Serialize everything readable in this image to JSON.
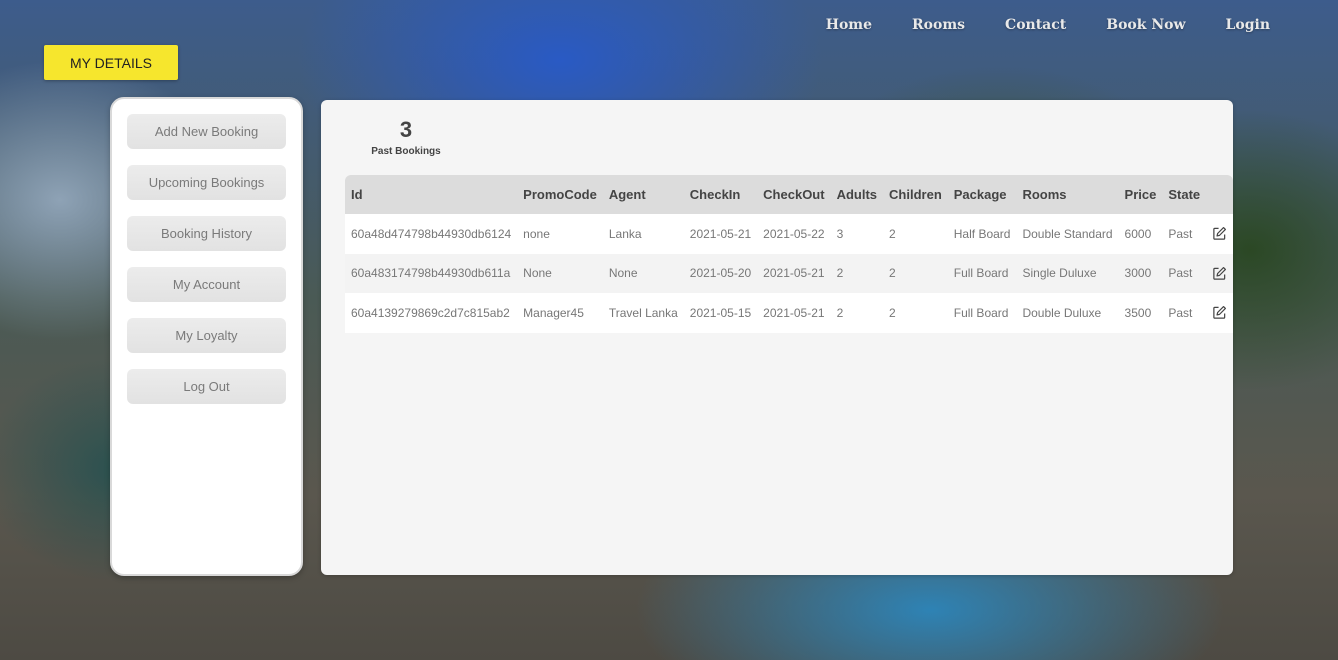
{
  "nav": {
    "items": [
      {
        "label": "Home"
      },
      {
        "label": "Rooms"
      },
      {
        "label": "Contact"
      },
      {
        "label": "Book Now"
      },
      {
        "label": "Login"
      }
    ]
  },
  "header": {
    "section_label": "MY DETAILS"
  },
  "sidebar": {
    "items": [
      {
        "label": "Add New Booking"
      },
      {
        "label": "Upcoming Bookings"
      },
      {
        "label": "Booking History"
      },
      {
        "label": "My Account"
      },
      {
        "label": "My Loyalty"
      },
      {
        "label": "Log Out"
      }
    ]
  },
  "summary": {
    "count": "3",
    "label": "Past Bookings"
  },
  "table": {
    "columns": [
      "Id",
      "PromoCode",
      "Agent",
      "CheckIn",
      "CheckOut",
      "Adults",
      "Children",
      "Package",
      "Rooms",
      "Price",
      "State"
    ],
    "rows": [
      [
        "60a48d474798b44930db6124",
        "none",
        "Lanka",
        "2021-05-21",
        "2021-05-22",
        "3",
        "2",
        "Half Board",
        "Double Standard",
        "6000",
        "Past"
      ],
      [
        "60a483174798b44930db611a",
        "None",
        "None",
        "2021-05-20",
        "2021-05-21",
        "2",
        "2",
        "Full Board",
        "Single Duluxe",
        "3000",
        "Past"
      ],
      [
        "60a4139279869c2d7c815ab2",
        "Manager45",
        "Travel Lanka",
        "2021-05-15",
        "2021-05-21",
        "2",
        "2",
        "Full Board",
        "Double Duluxe",
        "3500",
        "Past"
      ]
    ],
    "row_action_icon": "edit-icon"
  },
  "colors": {
    "accent_yellow": "#f6e62d",
    "panel_bg": "#f5f5f5",
    "header_bg": "#dcdcdc"
  }
}
